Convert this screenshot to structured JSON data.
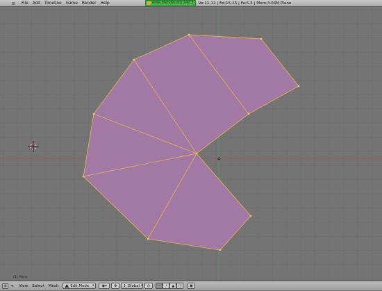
{
  "topbar": {
    "menu": [
      "File",
      "Add",
      "Timeline",
      "Game",
      "Render",
      "Help"
    ],
    "site": "www.blender.org 242.3",
    "stats": "Ve:11-11 | Ed:15-15 | Fa:5-5 | Mem:3.04M Plane"
  },
  "viewport": {
    "label": "(1) Plane",
    "background_color": "#747474",
    "grid_color": "#6a6a6a",
    "x_axis_color": "#9a5a5a",
    "y_axis_color": "#5a9a5a",
    "face_color": "#a57aa8",
    "edge_color": "#e0b050",
    "vertex_color": "#f2cc60"
  },
  "bottombar": {
    "menu": [
      "View",
      "Select",
      "Mesh"
    ],
    "mode": "Edit Mode",
    "orientation": "Global"
  }
}
